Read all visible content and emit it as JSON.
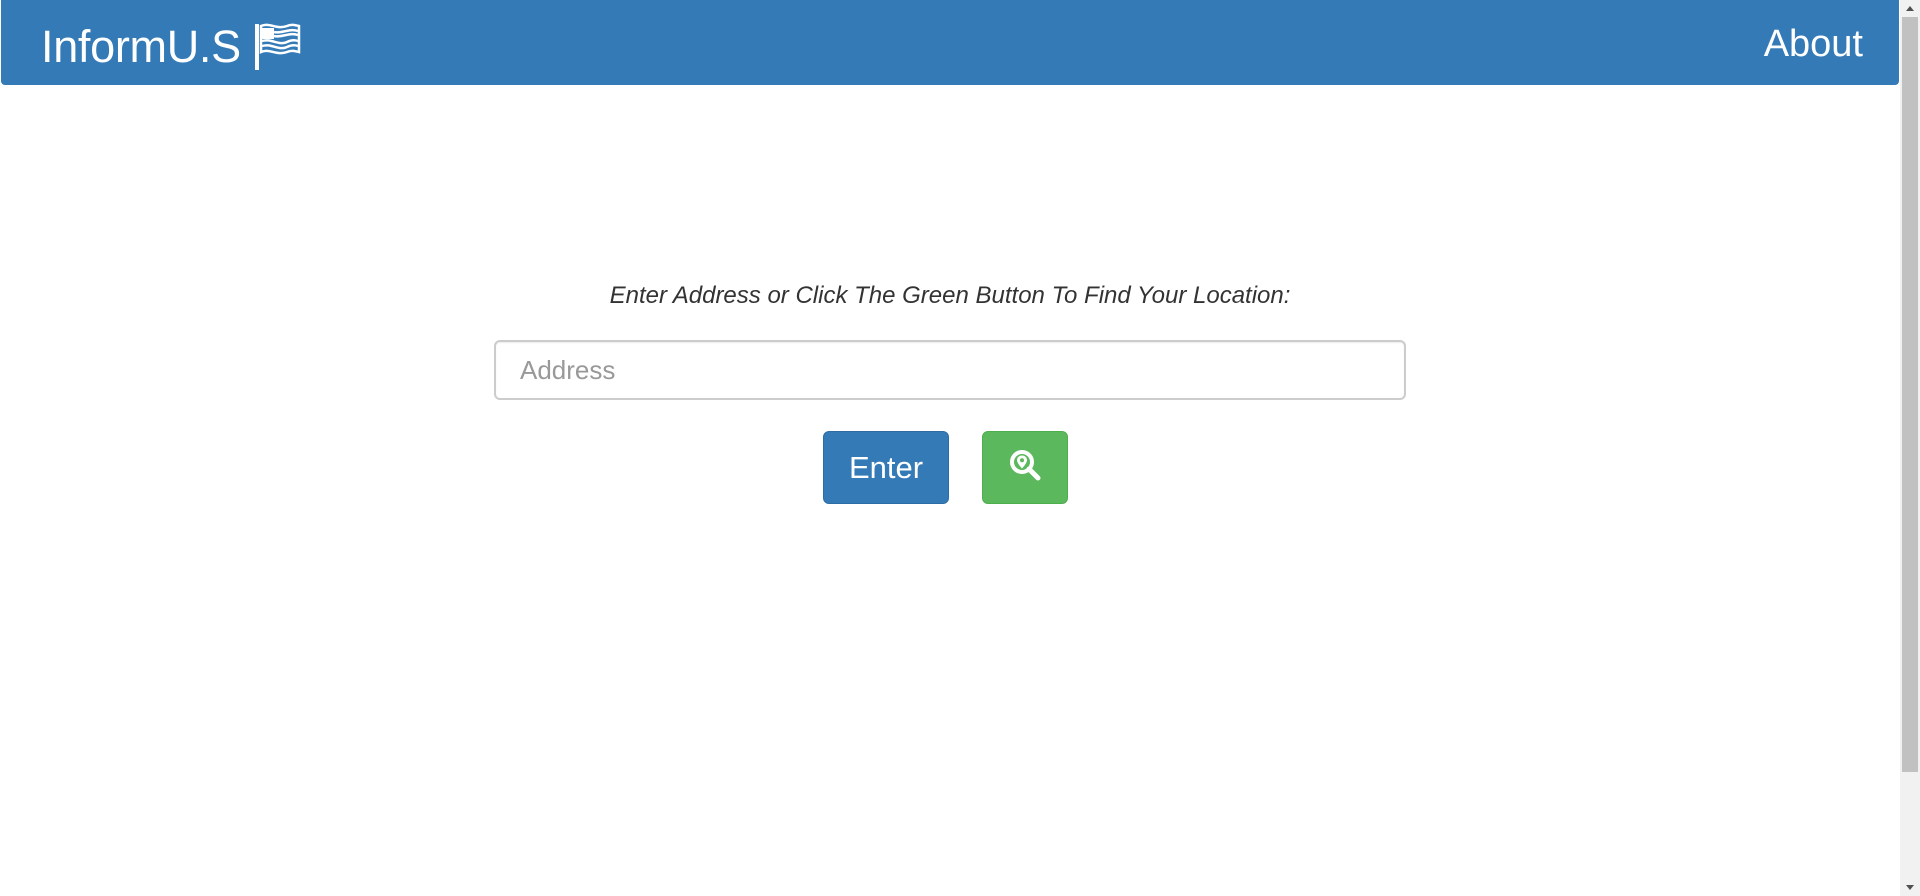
{
  "navbar": {
    "brand": "InformU.S",
    "brand_icon": "flag-icon",
    "about_label": "About",
    "color": "#337ab7"
  },
  "main": {
    "prompt": "Enter Address or Click The Green Button To Find Your Location:",
    "address_placeholder": "Address",
    "address_value": "",
    "enter_label": "Enter",
    "locate_icon": "location-search-icon",
    "enter_color": "#337ab7",
    "locate_color": "#5cb85c"
  }
}
